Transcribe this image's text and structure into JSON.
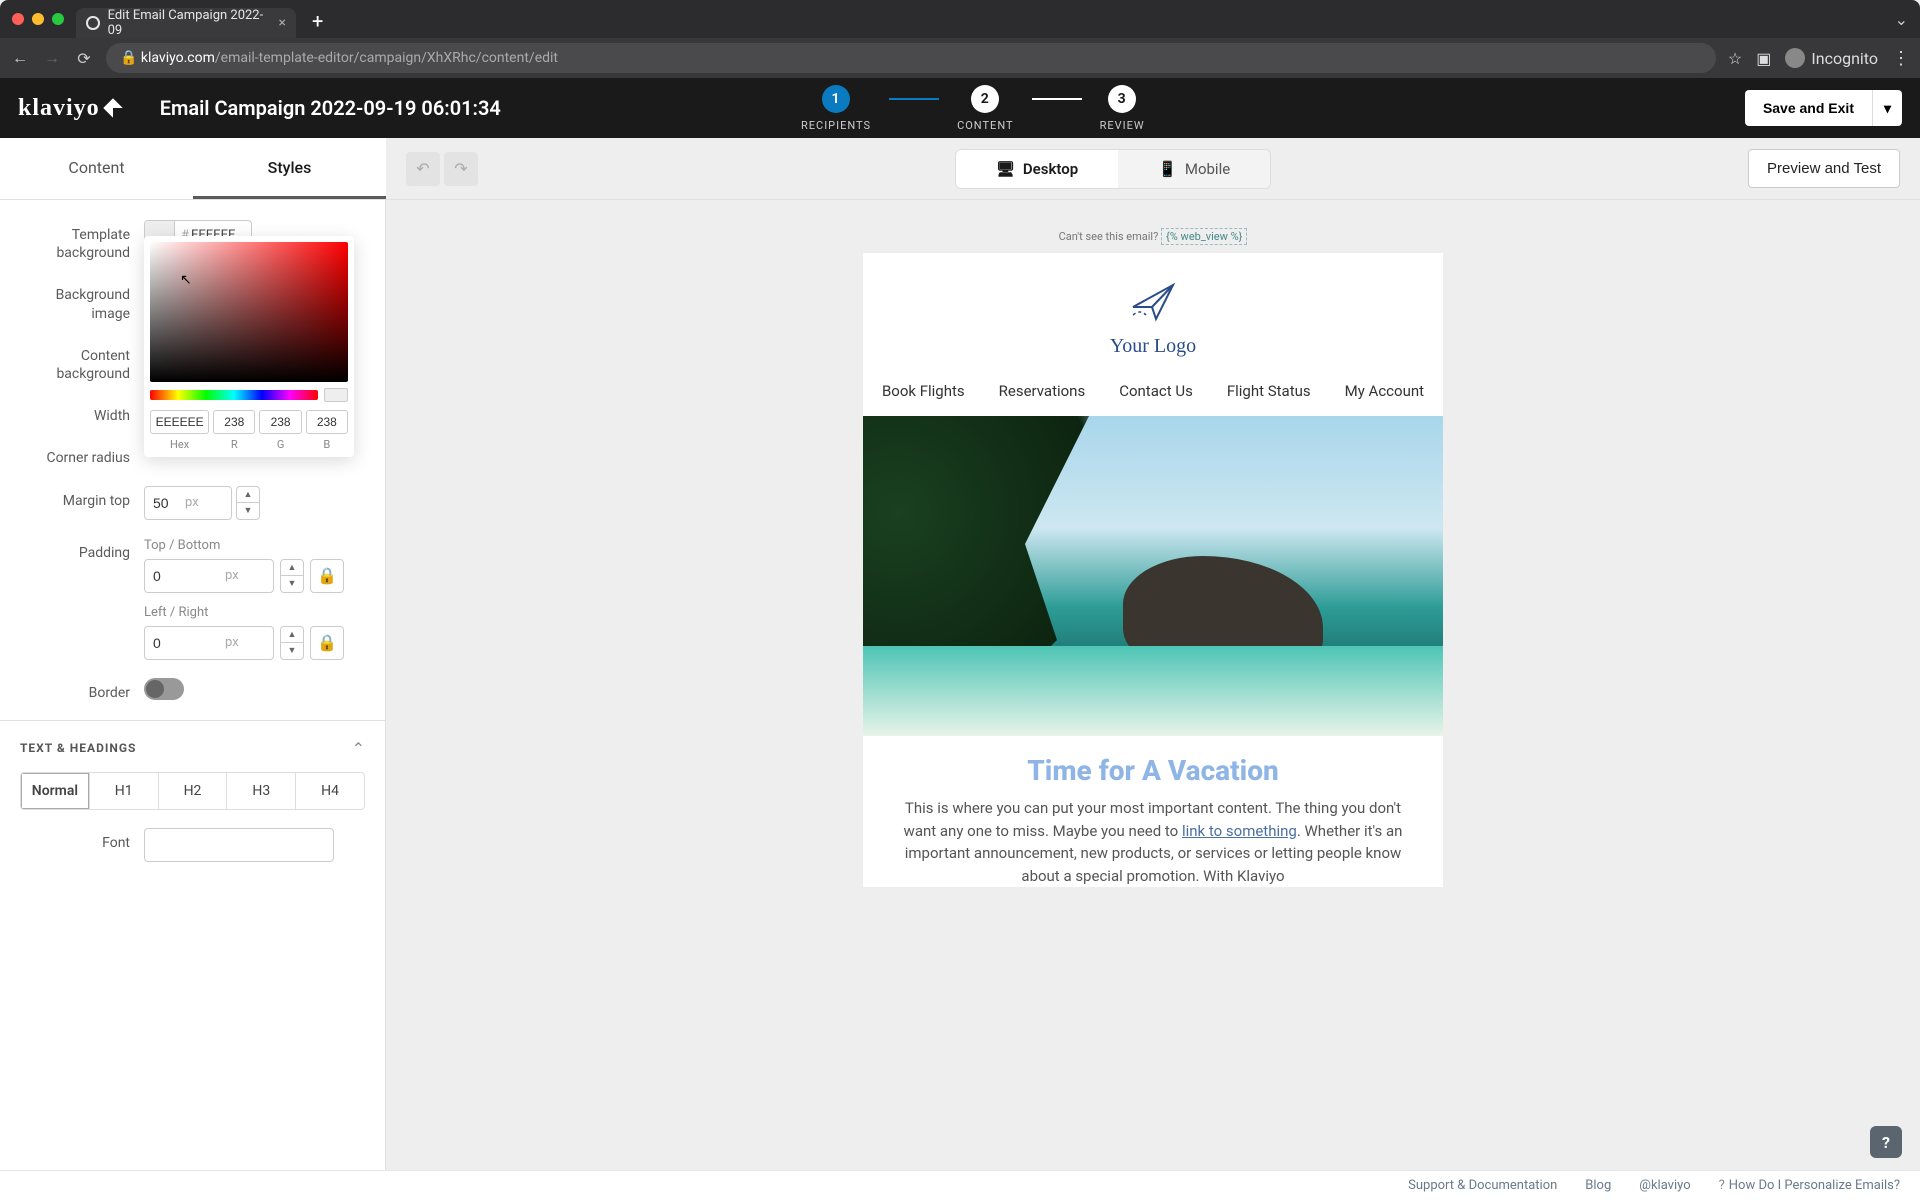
{
  "browser": {
    "tab_title": "Edit Email Campaign 2022-09",
    "url_domain": "klaviyo.com",
    "url_path": "/email-template-editor/campaign/XhXRhc/content/edit",
    "incognito_label": "Incognito"
  },
  "header": {
    "brand": "klaviyo",
    "campaign_title": "Email Campaign 2022-09-19 06:01:34",
    "steps": [
      {
        "num": "1",
        "label": "RECIPIENTS"
      },
      {
        "num": "2",
        "label": "CONTENT"
      },
      {
        "num": "3",
        "label": "REVIEW"
      }
    ],
    "save_exit": "Save and Exit"
  },
  "toolbar": {
    "tabs": {
      "content": "Content",
      "styles": "Styles"
    },
    "devices": {
      "desktop": "Desktop",
      "mobile": "Mobile"
    },
    "preview": "Preview and Test"
  },
  "styles_panel": {
    "template_bg_label": "Template background",
    "template_bg_value": "EEEEEE",
    "background_image_label": "Background image",
    "content_bg_label": "Content background",
    "width_label": "Width",
    "corner_radius_label": "Corner radius",
    "margin_top_label": "Margin top",
    "margin_top_value": "50",
    "margin_top_unit": "px",
    "padding_label": "Padding",
    "padding_tb_label": "Top / Bottom",
    "padding_tb_value": "0",
    "padding_lr_label": "Left / Right",
    "padding_lr_value": "0",
    "padding_unit": "px",
    "border_label": "Border",
    "text_headings_section": "TEXT & HEADINGS",
    "text_tabs": [
      "Normal",
      "H1",
      "H2",
      "H3",
      "H4"
    ],
    "font_label": "Font"
  },
  "color_picker": {
    "hex": "EEEEEE",
    "r": "238",
    "g": "238",
    "b": "238",
    "hex_label": "Hex",
    "r_label": "R",
    "g_label": "G",
    "b_label": "B"
  },
  "email": {
    "preheader_text": "Can't see this email? ",
    "preheader_tag": "{% web_view %}",
    "logo_text": "Your Logo",
    "nav": [
      "Book Flights",
      "Reservations",
      "Contact Us",
      "Flight Status",
      "My Account"
    ],
    "headline": "Time for A Vacation",
    "para_before": "This is where you can put your most important content. The thing you don't want any one to miss. Maybe you need to ",
    "para_link": "link to something",
    "para_after": ". Whether it's an important announcement, new products, or services or letting people know about a special promotion. With Klaviyo"
  },
  "footer": {
    "support": "Support & Documentation",
    "blog": "Blog",
    "handle": "@klaviyo",
    "personalize": "How Do I Personalize Emails?"
  }
}
